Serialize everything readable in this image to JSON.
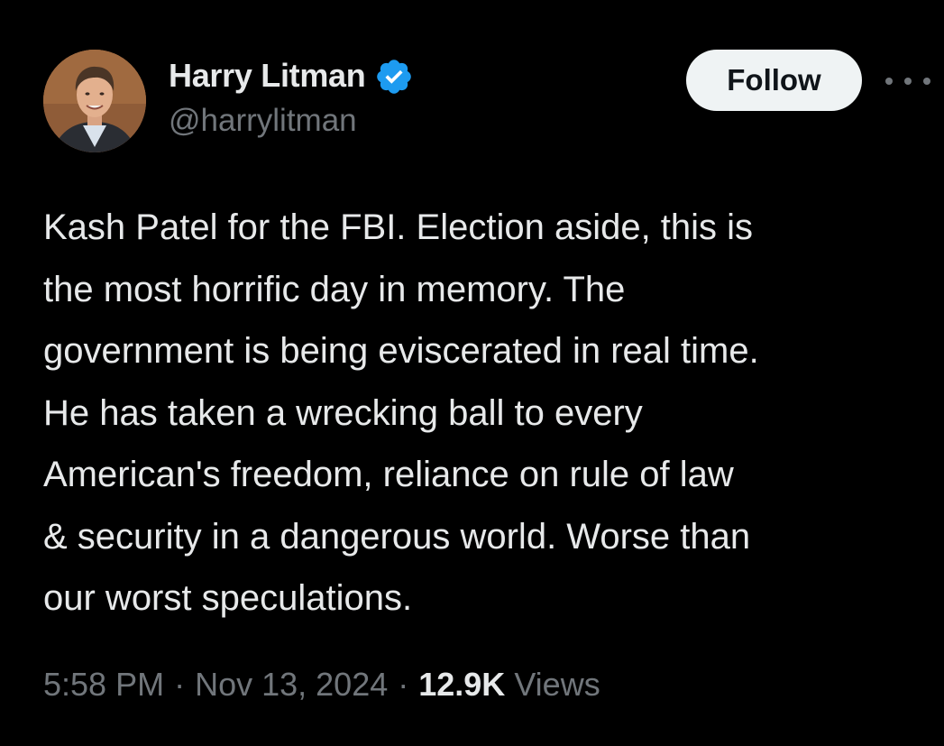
{
  "author": {
    "display_name": "Harry Litman",
    "handle": "@harrylitman",
    "verified": true,
    "verified_icon": "verified-badge-icon",
    "avatar_icon": "profile-photo"
  },
  "actions": {
    "follow_label": "Follow",
    "more_icon": "more-options-icon"
  },
  "tweet": {
    "lines": [
      "Kash Patel for the FBI. Election aside, this is",
      "the most horrific day in memory. The",
      "government is being eviscerated in real time.",
      "He has taken a wrecking ball to every",
      "American's freedom, reliance on rule of law",
      "& security in a dangerous world. Worse than",
      "our worst speculations."
    ]
  },
  "meta": {
    "time": "5:58 PM",
    "separator": "·",
    "date": "Nov 13, 2024",
    "views_count": "12.9K",
    "views_label": "Views"
  },
  "colors": {
    "background": "#000000",
    "primary_text": "#e7e9ea",
    "secondary_text": "#71767b",
    "verified_blue": "#1d9bf0",
    "follow_bg": "#eff3f4",
    "follow_text": "#0f1419"
  }
}
